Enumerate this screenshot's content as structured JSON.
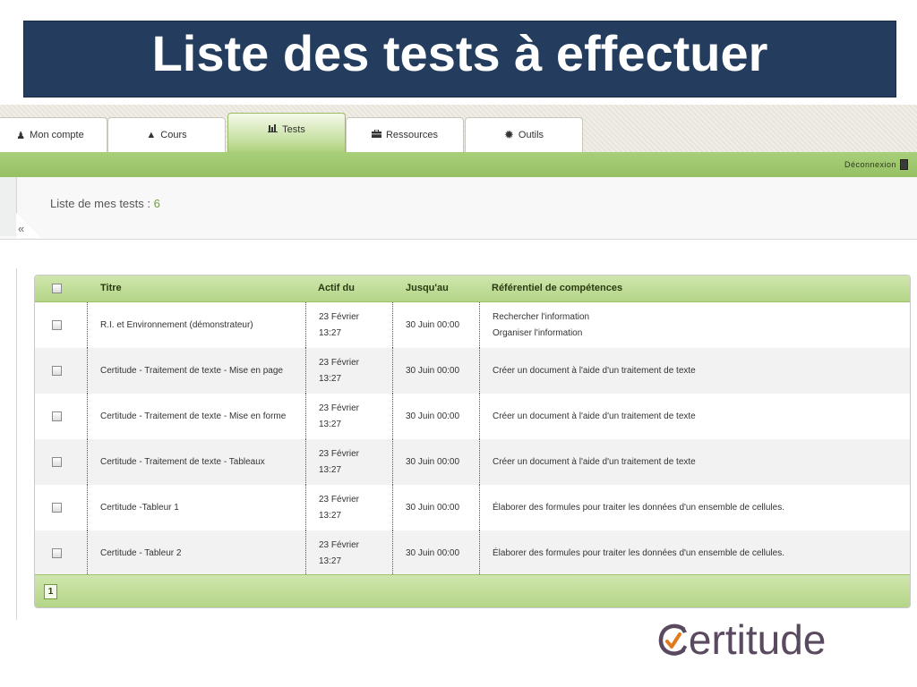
{
  "slide": {
    "title": "Liste des tests à effectuer"
  },
  "tabs": [
    {
      "label": "Mon compte",
      "icon": "user-icon"
    },
    {
      "label": "Cours",
      "icon": "graduation-cap-icon"
    },
    {
      "label": "Tests",
      "icon": "bar-chart-icon",
      "active": true
    },
    {
      "label": "Ressources",
      "icon": "briefcase-icon"
    },
    {
      "label": "Outils",
      "icon": "gear-icon"
    }
  ],
  "header": {
    "logout_label": "Déconnexion"
  },
  "list": {
    "label": "Liste de mes tests : ",
    "count": "6"
  },
  "table": {
    "columns": [
      "Titre",
      "Actif du",
      "Jusqu'au",
      "Référentiel de compétences"
    ],
    "rows": [
      {
        "title": "R.I. et Environnement (démonstrateur)",
        "active_date": "23 Février",
        "active_time": "13:27",
        "until": "30 Juin 00:00",
        "skills": [
          "Rechercher l'information",
          "Organiser l'information"
        ]
      },
      {
        "title": "Certitude - Traitement de texte - Mise en page",
        "active_date": "23 Février",
        "active_time": "13:27",
        "until": "30 Juin 00:00",
        "skills": [
          "Créer un document à l'aide d'un traitement de texte"
        ]
      },
      {
        "title": "Certitude - Traitement de texte - Mise en forme",
        "active_date": "23 Février",
        "active_time": "13:27",
        "until": "30 Juin 00:00",
        "skills": [
          "Créer un document à l'aide d'un traitement de texte"
        ]
      },
      {
        "title": "Certitude - Traitement de texte - Tableaux",
        "active_date": "23 Février",
        "active_time": "13:27",
        "until": "30 Juin 00:00",
        "skills": [
          "Créer un document à l'aide d'un traitement de texte"
        ]
      },
      {
        "title": "Certitude -Tableur 1",
        "active_date": "23 Février",
        "active_time": "13:27",
        "until": "30 Juin 00:00",
        "skills": [
          "Élaborer des formules pour traiter les données d'un ensemble de cellules."
        ]
      },
      {
        "title": "Certitude - Tableur 2",
        "active_date": "23 Février",
        "active_time": "13:27",
        "until": "30 Juin 00:00",
        "skills": [
          "Élaborer des formules pour traiter les données d'un ensemble de cellules."
        ]
      }
    ]
  },
  "pagination": {
    "current_page": "1"
  },
  "logo": {
    "text": "Certitude"
  },
  "colors": {
    "title_bg": "#243d5e",
    "green": "#a8cf79",
    "count_accent": "#6aa23a",
    "logo": "#5a4a5f",
    "logo_check": "#e07a1c"
  }
}
